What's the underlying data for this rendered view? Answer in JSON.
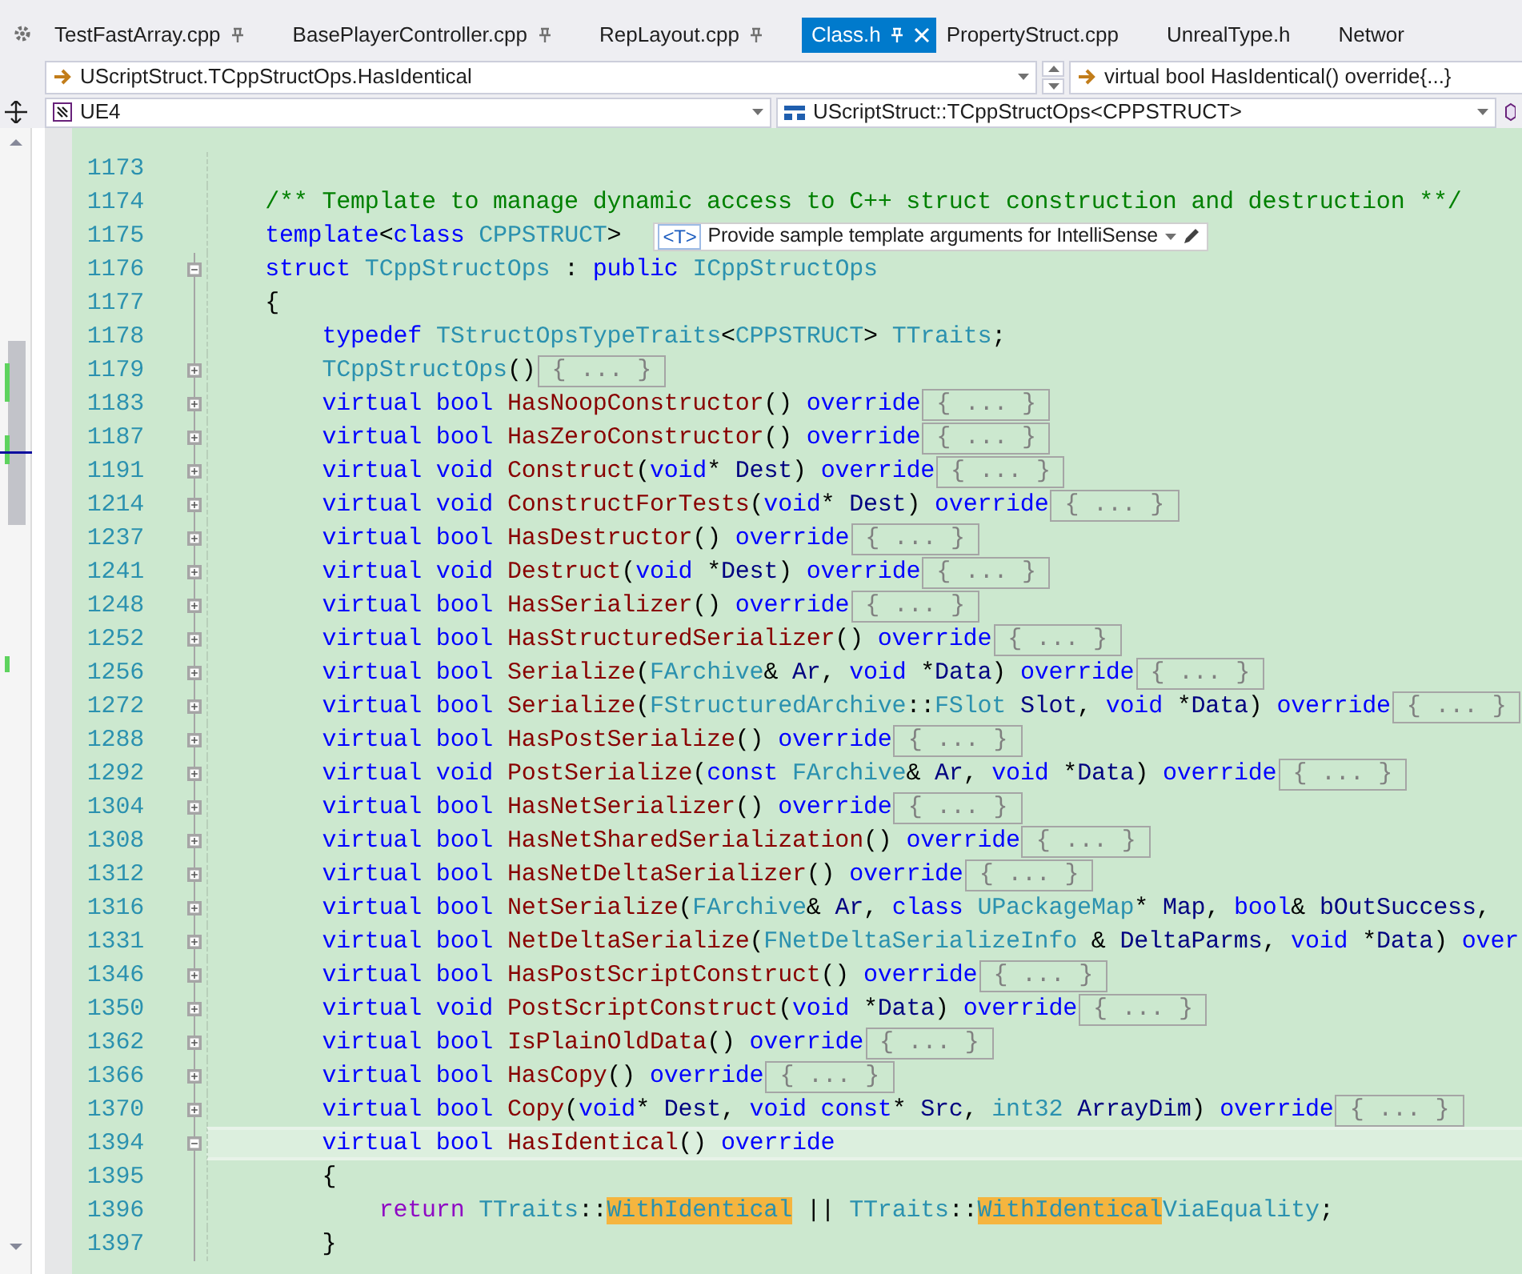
{
  "tabs": [
    {
      "label": "TestFastArray.cpp",
      "selected": false,
      "pinned": true
    },
    {
      "label": "BasePlayerController.cpp",
      "selected": false,
      "pinned": true
    },
    {
      "label": "RepLayout.cpp",
      "selected": false,
      "pinned": true
    },
    {
      "label": "Class.h",
      "selected": true,
      "pinned": true
    },
    {
      "label": "PropertyStruct.cpp",
      "selected": false,
      "pinned": false
    },
    {
      "label": "UnrealType.h",
      "selected": false,
      "pinned": false
    },
    {
      "label": "Networ",
      "selected": false,
      "pinned": false
    }
  ],
  "navigation": {
    "scope": "UScriptStruct.TCppStructOps.HasIdentical",
    "member": "virtual bool HasIdentical() override{...}"
  },
  "context": {
    "project": "UE4",
    "scope": "UScriptStruct::TCppStructOps<CPPSTRUCT>"
  },
  "editor": {
    "lines": [
      {
        "number": "1173",
        "current": false
      },
      {
        "number": "1174",
        "current": false,
        "tokens": [
          {
            "kind": "comment",
            "text": "    /** Template to manage dynamic access to C++ struct construction and destruction **/"
          }
        ]
      },
      {
        "number": "1175",
        "current": false,
        "tokens": [
          {
            "kind": "keyword",
            "text": "    template"
          },
          {
            "kind": "punct",
            "text": "<"
          },
          {
            "kind": "keyword",
            "text": "class "
          },
          {
            "kind": "type",
            "text": "CPPSTRUCT"
          },
          {
            "kind": "punct",
            "text": ">"
          }
        ],
        "hint": {
          "badge": "<T>",
          "text": "Provide sample template arguments for IntelliSense"
        }
      },
      {
        "number": "1176",
        "current": false,
        "fold": {
          "expanded": true
        },
        "tokens": [
          {
            "kind": "keyword",
            "text": "    struct "
          },
          {
            "kind": "type",
            "text": "TCppStructOps"
          },
          {
            "kind": "punct",
            "text": " : "
          },
          {
            "kind": "keyword",
            "text": "public "
          },
          {
            "kind": "type",
            "text": "ICppStructOps"
          }
        ]
      },
      {
        "number": "1177",
        "current": false,
        "tokens": [
          {
            "kind": "punct",
            "text": "    {"
          }
        ]
      },
      {
        "number": "1178",
        "current": false,
        "tokens": [
          {
            "kind": "keyword",
            "text": "        typedef "
          },
          {
            "kind": "type",
            "text": "TStructOpsTypeTraits"
          },
          {
            "kind": "punct",
            "text": "<"
          },
          {
            "kind": "type",
            "text": "CPPSTRUCT"
          },
          {
            "kind": "punct",
            "text": "> "
          },
          {
            "kind": "type",
            "text": "TTraits"
          },
          {
            "kind": "punct",
            "text": ";"
          }
        ]
      },
      {
        "number": "1179",
        "current": false,
        "fold": {
          "expanded": false
        },
        "folded": "{ ... }",
        "tokens": [
          {
            "kind": "type",
            "text": "        TCppStructOps"
          },
          {
            "kind": "punct",
            "text": "()"
          }
        ]
      },
      {
        "number": "1183",
        "current": false,
        "fold": {
          "expanded": false
        },
        "folded": "{ ... }",
        "tokens": [
          {
            "kind": "keyword",
            "text": "        virtual bool "
          },
          {
            "kind": "function",
            "text": "HasNoopConstructor"
          },
          {
            "kind": "punct",
            "text": "() "
          },
          {
            "kind": "keyword",
            "text": "override"
          }
        ]
      },
      {
        "number": "1187",
        "current": false,
        "fold": {
          "expanded": false
        },
        "folded": "{ ... }",
        "tokens": [
          {
            "kind": "keyword",
            "text": "        virtual bool "
          },
          {
            "kind": "function",
            "text": "HasZeroConstructor"
          },
          {
            "kind": "punct",
            "text": "() "
          },
          {
            "kind": "keyword",
            "text": "override"
          }
        ]
      },
      {
        "number": "1191",
        "current": false,
        "fold": {
          "expanded": false
        },
        "folded": "{ ... }",
        "tokens": [
          {
            "kind": "keyword",
            "text": "        virtual void "
          },
          {
            "kind": "function",
            "text": "Construct"
          },
          {
            "kind": "punct",
            "text": "("
          },
          {
            "kind": "keyword",
            "text": "void"
          },
          {
            "kind": "punct",
            "text": "* "
          },
          {
            "kind": "ident",
            "text": "Dest"
          },
          {
            "kind": "punct",
            "text": ") "
          },
          {
            "kind": "keyword",
            "text": "override"
          }
        ]
      },
      {
        "number": "1214",
        "current": false,
        "fold": {
          "expanded": false
        },
        "folded": "{ ... }",
        "tokens": [
          {
            "kind": "keyword",
            "text": "        virtual void "
          },
          {
            "kind": "function",
            "text": "ConstructForTests"
          },
          {
            "kind": "punct",
            "text": "("
          },
          {
            "kind": "keyword",
            "text": "void"
          },
          {
            "kind": "punct",
            "text": "* "
          },
          {
            "kind": "ident",
            "text": "Dest"
          },
          {
            "kind": "punct",
            "text": ") "
          },
          {
            "kind": "keyword",
            "text": "override"
          }
        ]
      },
      {
        "number": "1237",
        "current": false,
        "fold": {
          "expanded": false
        },
        "folded": "{ ... }",
        "tokens": [
          {
            "kind": "keyword",
            "text": "        virtual bool "
          },
          {
            "kind": "function",
            "text": "HasDestructor"
          },
          {
            "kind": "punct",
            "text": "() "
          },
          {
            "kind": "keyword",
            "text": "override"
          }
        ]
      },
      {
        "number": "1241",
        "current": false,
        "fold": {
          "expanded": false
        },
        "folded": "{ ... }",
        "tokens": [
          {
            "kind": "keyword",
            "text": "        virtual void "
          },
          {
            "kind": "function",
            "text": "Destruct"
          },
          {
            "kind": "punct",
            "text": "("
          },
          {
            "kind": "keyword",
            "text": "void "
          },
          {
            "kind": "punct",
            "text": "*"
          },
          {
            "kind": "ident",
            "text": "Dest"
          },
          {
            "kind": "punct",
            "text": ") "
          },
          {
            "kind": "keyword",
            "text": "override"
          }
        ]
      },
      {
        "number": "1248",
        "current": false,
        "fold": {
          "expanded": false
        },
        "folded": "{ ... }",
        "tokens": [
          {
            "kind": "keyword",
            "text": "        virtual bool "
          },
          {
            "kind": "function",
            "text": "HasSerializer"
          },
          {
            "kind": "punct",
            "text": "() "
          },
          {
            "kind": "keyword",
            "text": "override"
          }
        ]
      },
      {
        "number": "1252",
        "current": false,
        "fold": {
          "expanded": false
        },
        "folded": "{ ... }",
        "tokens": [
          {
            "kind": "keyword",
            "text": "        virtual bool "
          },
          {
            "kind": "function",
            "text": "HasStructuredSerializer"
          },
          {
            "kind": "punct",
            "text": "() "
          },
          {
            "kind": "keyword",
            "text": "override"
          }
        ]
      },
      {
        "number": "1256",
        "current": false,
        "fold": {
          "expanded": false
        },
        "folded": "{ ... }",
        "tokens": [
          {
            "kind": "keyword",
            "text": "        virtual bool "
          },
          {
            "kind": "function",
            "text": "Serialize"
          },
          {
            "kind": "punct",
            "text": "("
          },
          {
            "kind": "type",
            "text": "FArchive"
          },
          {
            "kind": "punct",
            "text": "& "
          },
          {
            "kind": "ident",
            "text": "Ar"
          },
          {
            "kind": "punct",
            "text": ", "
          },
          {
            "kind": "keyword",
            "text": "void "
          },
          {
            "kind": "punct",
            "text": "*"
          },
          {
            "kind": "ident",
            "text": "Data"
          },
          {
            "kind": "punct",
            "text": ") "
          },
          {
            "kind": "keyword",
            "text": "override"
          }
        ]
      },
      {
        "number": "1272",
        "current": false,
        "fold": {
          "expanded": false
        },
        "folded": "{ ... }",
        "tokens": [
          {
            "kind": "keyword",
            "text": "        virtual bool "
          },
          {
            "kind": "function",
            "text": "Serialize"
          },
          {
            "kind": "punct",
            "text": "("
          },
          {
            "kind": "type",
            "text": "FStructuredArchive"
          },
          {
            "kind": "punct",
            "text": "::"
          },
          {
            "kind": "type",
            "text": "FSlot "
          },
          {
            "kind": "ident",
            "text": "Slot"
          },
          {
            "kind": "punct",
            "text": ", "
          },
          {
            "kind": "keyword",
            "text": "void "
          },
          {
            "kind": "punct",
            "text": "*"
          },
          {
            "kind": "ident",
            "text": "Data"
          },
          {
            "kind": "punct",
            "text": ") "
          },
          {
            "kind": "keyword",
            "text": "override"
          }
        ]
      },
      {
        "number": "1288",
        "current": false,
        "fold": {
          "expanded": false
        },
        "folded": "{ ... }",
        "tokens": [
          {
            "kind": "keyword",
            "text": "        virtual bool "
          },
          {
            "kind": "function",
            "text": "HasPostSerialize"
          },
          {
            "kind": "punct",
            "text": "() "
          },
          {
            "kind": "keyword",
            "text": "override"
          }
        ]
      },
      {
        "number": "1292",
        "current": false,
        "fold": {
          "expanded": false
        },
        "folded": "{ ... }",
        "tokens": [
          {
            "kind": "keyword",
            "text": "        virtual void "
          },
          {
            "kind": "function",
            "text": "PostSerialize"
          },
          {
            "kind": "punct",
            "text": "("
          },
          {
            "kind": "keyword",
            "text": "const "
          },
          {
            "kind": "type",
            "text": "FArchive"
          },
          {
            "kind": "punct",
            "text": "& "
          },
          {
            "kind": "ident",
            "text": "Ar"
          },
          {
            "kind": "punct",
            "text": ", "
          },
          {
            "kind": "keyword",
            "text": "void "
          },
          {
            "kind": "punct",
            "text": "*"
          },
          {
            "kind": "ident",
            "text": "Data"
          },
          {
            "kind": "punct",
            "text": ") "
          },
          {
            "kind": "keyword",
            "text": "override"
          }
        ]
      },
      {
        "number": "1304",
        "current": false,
        "fold": {
          "expanded": false
        },
        "folded": "{ ... }",
        "tokens": [
          {
            "kind": "keyword",
            "text": "        virtual bool "
          },
          {
            "kind": "function",
            "text": "HasNetSerializer"
          },
          {
            "kind": "punct",
            "text": "() "
          },
          {
            "kind": "keyword",
            "text": "override"
          }
        ]
      },
      {
        "number": "1308",
        "current": false,
        "fold": {
          "expanded": false
        },
        "folded": "{ ... }",
        "tokens": [
          {
            "kind": "keyword",
            "text": "        virtual bool "
          },
          {
            "kind": "function",
            "text": "HasNetSharedSerialization"
          },
          {
            "kind": "punct",
            "text": "() "
          },
          {
            "kind": "keyword",
            "text": "override"
          }
        ]
      },
      {
        "number": "1312",
        "current": false,
        "fold": {
          "expanded": false
        },
        "folded": "{ ... }",
        "tokens": [
          {
            "kind": "keyword",
            "text": "        virtual bool "
          },
          {
            "kind": "function",
            "text": "HasNetDeltaSerializer"
          },
          {
            "kind": "punct",
            "text": "() "
          },
          {
            "kind": "keyword",
            "text": "override"
          }
        ]
      },
      {
        "number": "1316",
        "current": false,
        "fold": {
          "expanded": false
        },
        "tokens": [
          {
            "kind": "keyword",
            "text": "        virtual bool "
          },
          {
            "kind": "function",
            "text": "NetSerialize"
          },
          {
            "kind": "punct",
            "text": "("
          },
          {
            "kind": "type",
            "text": "FArchive"
          },
          {
            "kind": "punct",
            "text": "& "
          },
          {
            "kind": "ident",
            "text": "Ar"
          },
          {
            "kind": "punct",
            "text": ", "
          },
          {
            "kind": "keyword",
            "text": "class "
          },
          {
            "kind": "type",
            "text": "UPackageMap"
          },
          {
            "kind": "punct",
            "text": "* "
          },
          {
            "kind": "ident",
            "text": "Map"
          },
          {
            "kind": "punct",
            "text": ", "
          },
          {
            "kind": "keyword",
            "text": "bool"
          },
          {
            "kind": "punct",
            "text": "& "
          },
          {
            "kind": "ident",
            "text": "bOutSuccess"
          },
          {
            "kind": "punct",
            "text": ","
          }
        ]
      },
      {
        "number": "1331",
        "current": false,
        "fold": {
          "expanded": false
        },
        "tokens": [
          {
            "kind": "keyword",
            "text": "        virtual bool "
          },
          {
            "kind": "function",
            "text": "NetDeltaSerialize"
          },
          {
            "kind": "punct",
            "text": "("
          },
          {
            "kind": "type",
            "text": "FNetDeltaSerializeInfo "
          },
          {
            "kind": "punct",
            "text": "& "
          },
          {
            "kind": "ident",
            "text": "DeltaParms"
          },
          {
            "kind": "punct",
            "text": ", "
          },
          {
            "kind": "keyword",
            "text": "void "
          },
          {
            "kind": "punct",
            "text": "*"
          },
          {
            "kind": "ident",
            "text": "Data"
          },
          {
            "kind": "punct",
            "text": ") "
          },
          {
            "kind": "keyword",
            "text": "over"
          }
        ]
      },
      {
        "number": "1346",
        "current": false,
        "fold": {
          "expanded": false
        },
        "folded": "{ ... }",
        "tokens": [
          {
            "kind": "keyword",
            "text": "        virtual bool "
          },
          {
            "kind": "function",
            "text": "HasPostScriptConstruct"
          },
          {
            "kind": "punct",
            "text": "() "
          },
          {
            "kind": "keyword",
            "text": "override"
          }
        ]
      },
      {
        "number": "1350",
        "current": false,
        "fold": {
          "expanded": false
        },
        "folded": "{ ... }",
        "tokens": [
          {
            "kind": "keyword",
            "text": "        virtual void "
          },
          {
            "kind": "function",
            "text": "PostScriptConstruct"
          },
          {
            "kind": "punct",
            "text": "("
          },
          {
            "kind": "keyword",
            "text": "void "
          },
          {
            "kind": "punct",
            "text": "*"
          },
          {
            "kind": "ident",
            "text": "Data"
          },
          {
            "kind": "punct",
            "text": ") "
          },
          {
            "kind": "keyword",
            "text": "override"
          }
        ]
      },
      {
        "number": "1362",
        "current": false,
        "fold": {
          "expanded": false
        },
        "folded": "{ ... }",
        "tokens": [
          {
            "kind": "keyword",
            "text": "        virtual bool "
          },
          {
            "kind": "function",
            "text": "IsPlainOldData"
          },
          {
            "kind": "punct",
            "text": "() "
          },
          {
            "kind": "keyword",
            "text": "override"
          }
        ]
      },
      {
        "number": "1366",
        "current": false,
        "fold": {
          "expanded": false
        },
        "folded": "{ ... }",
        "tokens": [
          {
            "kind": "keyword",
            "text": "        virtual bool "
          },
          {
            "kind": "function",
            "text": "HasCopy"
          },
          {
            "kind": "punct",
            "text": "() "
          },
          {
            "kind": "keyword",
            "text": "override"
          }
        ]
      },
      {
        "number": "1370",
        "current": false,
        "fold": {
          "expanded": false
        },
        "folded": "{ ... }",
        "tokens": [
          {
            "kind": "keyword",
            "text": "        virtual bool "
          },
          {
            "kind": "function",
            "text": "Copy"
          },
          {
            "kind": "punct",
            "text": "("
          },
          {
            "kind": "keyword",
            "text": "void"
          },
          {
            "kind": "punct",
            "text": "* "
          },
          {
            "kind": "ident",
            "text": "Dest"
          },
          {
            "kind": "punct",
            "text": ", "
          },
          {
            "kind": "keyword",
            "text": "void const"
          },
          {
            "kind": "punct",
            "text": "* "
          },
          {
            "kind": "ident",
            "text": "Src"
          },
          {
            "kind": "punct",
            "text": ", "
          },
          {
            "kind": "type",
            "text": "int32 "
          },
          {
            "kind": "ident",
            "text": "ArrayDim"
          },
          {
            "kind": "punct",
            "text": ") "
          },
          {
            "kind": "keyword",
            "text": "override"
          }
        ]
      },
      {
        "number": "1394",
        "current": true,
        "fold": {
          "expanded": true
        },
        "tokens": [
          {
            "kind": "keyword",
            "text": "        virtual bool "
          },
          {
            "kind": "function",
            "text": "HasIdentical"
          },
          {
            "kind": "punct",
            "text": "() "
          },
          {
            "kind": "keyword",
            "text": "override"
          }
        ]
      },
      {
        "number": "1395",
        "current": false,
        "tokens": [
          {
            "kind": "punct",
            "text": "        {"
          }
        ]
      },
      {
        "number": "1396",
        "current": false,
        "tokens": [
          {
            "kind": "control",
            "text": "            return "
          },
          {
            "kind": "type",
            "text": "TTraits"
          },
          {
            "kind": "punct",
            "text": "::"
          },
          {
            "kind": "match",
            "text": "WithIdentical"
          },
          {
            "kind": "punct",
            "text": " || "
          },
          {
            "kind": "type",
            "text": "TTraits"
          },
          {
            "kind": "punct",
            "text": "::"
          },
          {
            "kind": "match",
            "text": "WithIdentical"
          },
          {
            "kind": "type",
            "text": "ViaEquality"
          },
          {
            "kind": "punct",
            "text": ";"
          }
        ]
      },
      {
        "number": "1397",
        "current": false,
        "tokens": [
          {
            "kind": "punct",
            "text": "        }"
          }
        ]
      }
    ]
  }
}
